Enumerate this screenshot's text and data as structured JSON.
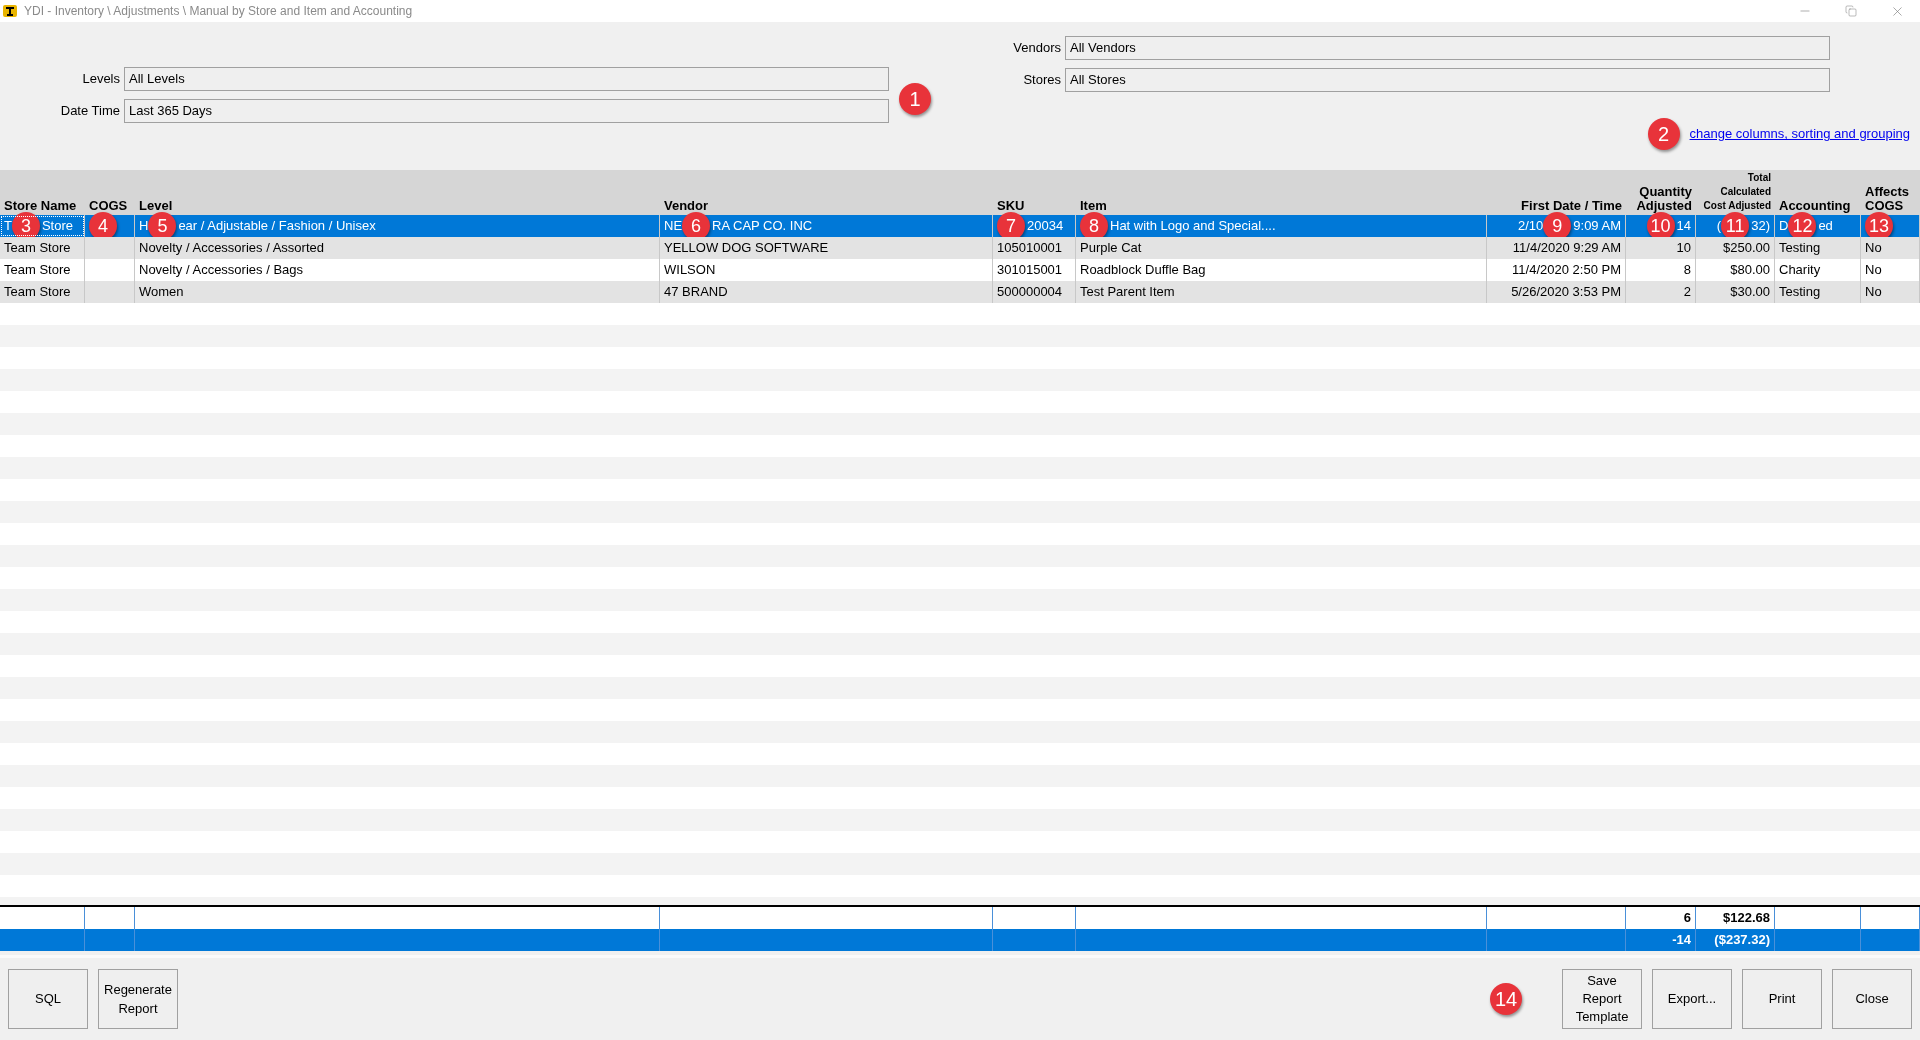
{
  "window": {
    "title": "YDI - Inventory \\ Adjustments \\ Manual by Store and Item and Accounting"
  },
  "filters_left": [
    {
      "label": "Levels",
      "value": "All Levels"
    },
    {
      "label": "Date Time",
      "value": "Last 365 Days"
    }
  ],
  "filters_right": [
    {
      "label": "Vendors",
      "value": "All Vendors"
    },
    {
      "label": "Stores",
      "value": "All Stores"
    }
  ],
  "filters_badge": "1",
  "link": {
    "text": "change columns, sorting and grouping",
    "badge": "2"
  },
  "table": {
    "columns": [
      "Store Name",
      "COGS",
      "Level",
      "Vendor",
      "SKU",
      "Item",
      "First Date / Time",
      "Quantity Adjusted",
      "Total Calculated Cost Adjusted",
      "Accounting",
      "Affects COGS"
    ],
    "rows": [
      {
        "selected": true,
        "cells": [
          {
            "pre": "T",
            "badge": "3",
            "post": "Store"
          },
          {
            "badge": "4"
          },
          {
            "pre": "H",
            "badge": "5",
            "post": "ear / Adjustable / Fashion / Unisex"
          },
          {
            "pre": "NE",
            "badge": "6",
            "post": "RA CAP CO. INC"
          },
          {
            "badge": "7",
            "post": "20034"
          },
          {
            "badge": "8",
            "post": "Hat with Logo and Special...."
          },
          {
            "pre": "2/10",
            "badge": "9",
            "post": "9:09 AM"
          },
          {
            "badge": "10",
            "post": "14"
          },
          {
            "pre": "(",
            "badge": "11",
            "post": "32)"
          },
          {
            "pre": "D",
            "badge": "12",
            "post": "ed"
          },
          {
            "badge": "13"
          }
        ]
      },
      {
        "selected": false,
        "cells": [
          {
            "post": "Team Store"
          },
          {},
          {
            "post": "Novelty / Accessories / Assorted"
          },
          {
            "post": "YELLOW DOG SOFTWARE"
          },
          {
            "post": "105010001"
          },
          {
            "post": "Purple Cat"
          },
          {
            "post": "11/4/2020 9:29 AM"
          },
          {
            "post": "10"
          },
          {
            "post": "$250.00"
          },
          {
            "post": "Testing"
          },
          {
            "post": "No"
          }
        ]
      },
      {
        "selected": false,
        "cells": [
          {
            "post": "Team Store"
          },
          {},
          {
            "post": "Novelty / Accessories / Bags"
          },
          {
            "post": "WILSON"
          },
          {
            "post": "301015001"
          },
          {
            "post": "Roadblock Duffle Bag"
          },
          {
            "post": "11/4/2020 2:50 PM"
          },
          {
            "post": "8"
          },
          {
            "post": "$80.00"
          },
          {
            "post": "Charity"
          },
          {
            "post": "No"
          }
        ]
      },
      {
        "selected": false,
        "cells": [
          {
            "post": "Team Store"
          },
          {},
          {
            "post": "Women"
          },
          {
            "post": "47 BRAND"
          },
          {
            "post": "500000004"
          },
          {
            "post": "Test Parent Item"
          },
          {
            "post": "5/26/2020 3:53 PM"
          },
          {
            "post": "2"
          },
          {
            "post": "$30.00"
          },
          {
            "post": "Testing"
          },
          {
            "post": "No"
          }
        ]
      }
    ],
    "totals": [
      {
        "highlighted": false,
        "quantity": "6",
        "cost": "$122.68"
      },
      {
        "highlighted": true,
        "quantity": "-14",
        "cost": "($237.32)"
      }
    ]
  },
  "buttons_left": [
    "SQL",
    "Regenerate Report"
  ],
  "buttons_badge": "14",
  "buttons_right": [
    "Save Report Template",
    "Export...",
    "Print",
    "Close"
  ]
}
